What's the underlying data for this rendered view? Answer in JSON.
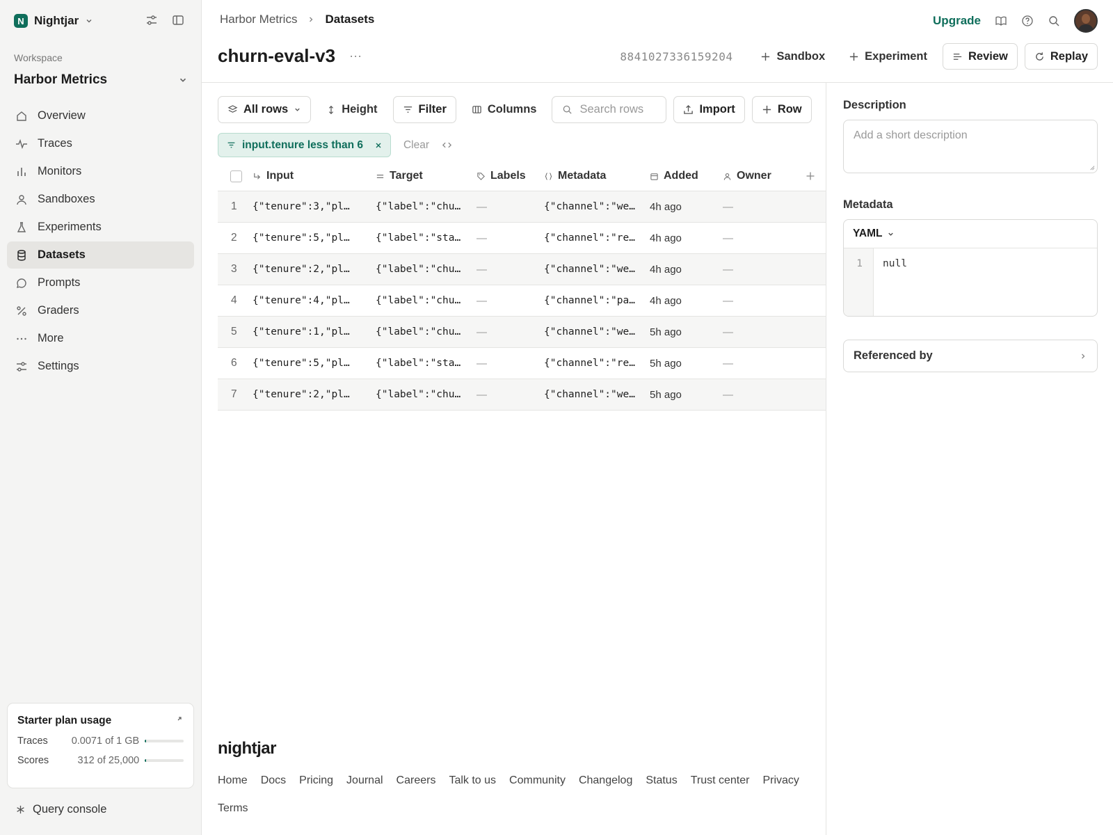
{
  "workspace": {
    "brand": "Nightjar",
    "brand_initial": "N",
    "label": "Workspace",
    "name": "Harbor Metrics"
  },
  "nav": [
    {
      "label": "Overview",
      "icon": "home-icon"
    },
    {
      "label": "Traces",
      "icon": "pulse-icon"
    },
    {
      "label": "Monitors",
      "icon": "bar-chart-icon"
    },
    {
      "label": "Sandboxes",
      "icon": "user-icon"
    },
    {
      "label": "Experiments",
      "icon": "flask-icon"
    },
    {
      "label": "Datasets",
      "icon": "database-icon",
      "active": true
    },
    {
      "label": "Prompts",
      "icon": "chat-icon"
    },
    {
      "label": "Graders",
      "icon": "percent-icon"
    },
    {
      "label": "More",
      "icon": "dots-icon"
    },
    {
      "label": "Settings",
      "icon": "sliders-icon"
    }
  ],
  "usage": {
    "title": "Starter plan usage",
    "rows": [
      {
        "label": "Traces",
        "value": "0.0071 of 1 GB",
        "fraction": 0.0071
      },
      {
        "label": "Scores",
        "value": "312 of 25,000",
        "fraction": 0.0125
      }
    ]
  },
  "query_console": "Query console",
  "breadcrumb": {
    "parent": "Harbor Metrics",
    "current": "Datasets"
  },
  "header": {
    "upgrade": "Upgrade"
  },
  "dataset": {
    "title": "churn-eval-v3",
    "more": "···",
    "id": "8841027336159204",
    "actions": {
      "sandbox": "Sandbox",
      "experiment": "Experiment",
      "review": "Review",
      "replay": "Replay"
    }
  },
  "toolbar": {
    "all_rows": "All rows",
    "height": "Height",
    "filter": "Filter",
    "columns": "Columns",
    "search_placeholder": "Search rows",
    "import": "Import",
    "row": "Row"
  },
  "filter": {
    "chip": "input.tenure less than 6",
    "clear": "Clear"
  },
  "table": {
    "columns": [
      "Input",
      "Target",
      "Labels",
      "Metadata",
      "Added",
      "Owner"
    ],
    "rows": [
      {
        "n": "1",
        "input": "{\"tenure\":3,\"pl…",
        "target": "{\"label\":\"chu…",
        "labels": "—",
        "metadata": "{\"channel\":\"we…",
        "added": "4h ago",
        "owner": "—"
      },
      {
        "n": "2",
        "input": "{\"tenure\":5,\"pl…",
        "target": "{\"label\":\"sta…",
        "labels": "—",
        "metadata": "{\"channel\":\"re…",
        "added": "4h ago",
        "owner": "—"
      },
      {
        "n": "3",
        "input": "{\"tenure\":2,\"pl…",
        "target": "{\"label\":\"chu…",
        "labels": "—",
        "metadata": "{\"channel\":\"we…",
        "added": "4h ago",
        "owner": "—"
      },
      {
        "n": "4",
        "input": "{\"tenure\":4,\"pl…",
        "target": "{\"label\":\"chu…",
        "labels": "—",
        "metadata": "{\"channel\":\"pa…",
        "added": "4h ago",
        "owner": "—"
      },
      {
        "n": "5",
        "input": "{\"tenure\":1,\"pl…",
        "target": "{\"label\":\"chu…",
        "labels": "—",
        "metadata": "{\"channel\":\"we…",
        "added": "5h ago",
        "owner": "—"
      },
      {
        "n": "6",
        "input": "{\"tenure\":5,\"pl…",
        "target": "{\"label\":\"sta…",
        "labels": "—",
        "metadata": "{\"channel\":\"re…",
        "added": "5h ago",
        "owner": "—"
      },
      {
        "n": "7",
        "input": "{\"tenure\":2,\"pl…",
        "target": "{\"label\":\"chu…",
        "labels": "—",
        "metadata": "{\"channel\":\"we…",
        "added": "5h ago",
        "owner": "—"
      }
    ]
  },
  "panel": {
    "description_label": "Description",
    "description_placeholder": "Add a short description",
    "metadata_label": "Metadata",
    "format": "YAML",
    "line_number": "1",
    "code": "null",
    "referenced_by": "Referenced by"
  },
  "footer": {
    "brand": "nightjar",
    "links": [
      "Home",
      "Docs",
      "Pricing",
      "Journal",
      "Careers",
      "Talk to us",
      "Community",
      "Changelog",
      "Status",
      "Trust center",
      "Privacy",
      "Terms"
    ]
  },
  "colors": {
    "accent": "#0f6e5b",
    "chip_bg": "#e3f1ec",
    "sidebar_bg": "#f4f4f3"
  }
}
